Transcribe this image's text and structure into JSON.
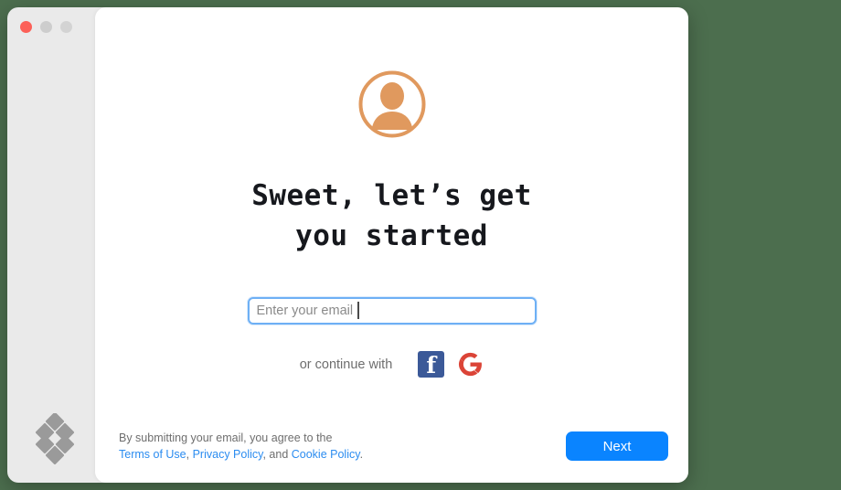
{
  "desktop": {
    "background_color": "#4c6e4e"
  },
  "window": {
    "traffic_lights": [
      {
        "name": "close",
        "color": "#fc6058"
      },
      {
        "name": "minimize",
        "color": "#cdcdcd"
      },
      {
        "name": "maximize",
        "color": "#d3d3d3"
      }
    ],
    "sidebar": {
      "background_color": "#eaeaea",
      "logo_name": "diamond-cluster-logo",
      "logo_color": "#9a9a9a"
    }
  },
  "main": {
    "avatar_icon": "user-avatar-icon",
    "avatar_color": "#e0995e",
    "heading": "Sweet, let’s get\nyou started",
    "email": {
      "value": "",
      "placeholder": "Enter your email",
      "focused": true,
      "border_color": "#6eb0f5"
    },
    "social": {
      "label": "or continue with",
      "providers": [
        {
          "name": "facebook",
          "glyph": "f",
          "color": "#3b5998"
        },
        {
          "name": "google",
          "glyph": "G",
          "color": "#db4437"
        }
      ]
    }
  },
  "footer": {
    "legal_prefix": "By submitting your email, you agree to the",
    "terms_label": "Terms of Use",
    "separator_1": ", ",
    "privacy_label": "Privacy Policy",
    "separator_2": ", and ",
    "cookie_label": "Cookie Policy",
    "period": ".",
    "next_label": "Next",
    "next_color": "#0a84ff"
  }
}
